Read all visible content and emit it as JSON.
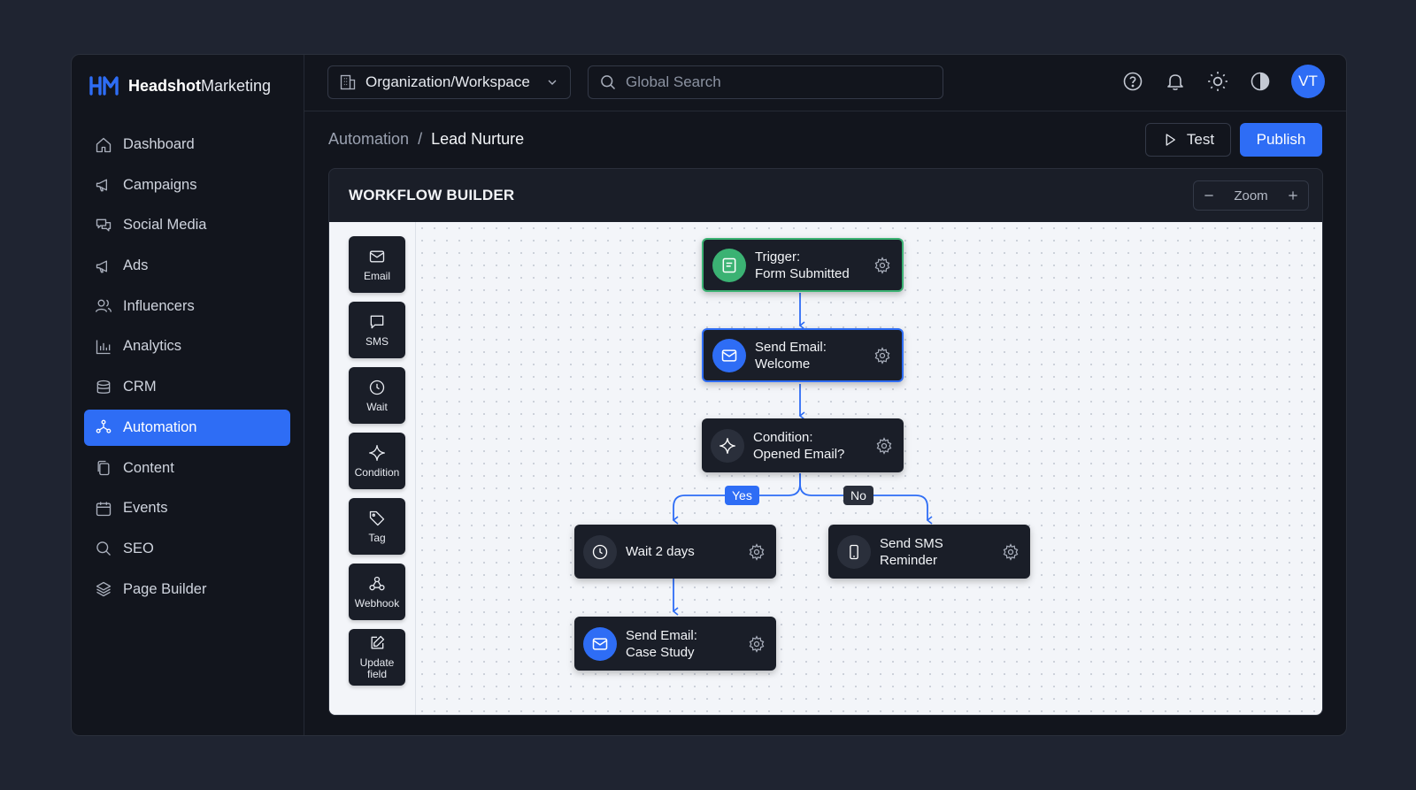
{
  "brand": {
    "bold": "Headshot",
    "regular": "Marketing"
  },
  "sidebar": {
    "items": [
      {
        "label": "Dashboard",
        "icon": "home-icon"
      },
      {
        "label": "Campaigns",
        "icon": "megaphone-icon"
      },
      {
        "label": "Social Media",
        "icon": "chat-icon"
      },
      {
        "label": "Ads",
        "icon": "megaphone-icon"
      },
      {
        "label": "Influencers",
        "icon": "users-icon"
      },
      {
        "label": "Analytics",
        "icon": "bar-chart-icon"
      },
      {
        "label": "CRM",
        "icon": "database-icon"
      },
      {
        "label": "Automation",
        "icon": "automation-icon",
        "active": true
      },
      {
        "label": "Content",
        "icon": "copy-icon"
      },
      {
        "label": "Events",
        "icon": "calendar-icon"
      },
      {
        "label": "SEO",
        "icon": "search-icon"
      },
      {
        "label": "Page Builder",
        "icon": "layers-icon"
      }
    ]
  },
  "header": {
    "workspace": "Organization/Workspace",
    "search_placeholder": "Global Search",
    "avatar": "VT"
  },
  "breadcrumb": {
    "parent": "Automation",
    "separator": "/",
    "current": "Lead Nurture"
  },
  "actions": {
    "test": "Test",
    "publish": "Publish"
  },
  "workflow": {
    "title": "WORKFLOW BUILDER",
    "zoom_label": "Zoom",
    "palette": [
      {
        "label": "Email",
        "icon": "mail-icon"
      },
      {
        "label": "SMS",
        "icon": "message-icon"
      },
      {
        "label": "Wait",
        "icon": "clock-icon"
      },
      {
        "label": "Condition",
        "icon": "sparkle-icon"
      },
      {
        "label": "Tag",
        "icon": "tag-icon"
      },
      {
        "label": "Webhook",
        "icon": "webhook-icon"
      },
      {
        "label": "Update field",
        "icon": "edit-icon"
      }
    ],
    "nodes": {
      "trigger": {
        "line1": "Trigger:",
        "line2": "Form Submitted"
      },
      "email_welcome": {
        "line1": "Send Email:",
        "line2": "Welcome"
      },
      "condition": {
        "line1": "Condition:",
        "line2": "Opened Email?"
      },
      "wait": {
        "line1": "Wait 2 days",
        "line2": ""
      },
      "sms": {
        "line1": "Send SMS",
        "line2": "Reminder"
      },
      "email_case": {
        "line1": "Send Email:",
        "line2": "Case Study"
      }
    },
    "branches": {
      "yes": "Yes",
      "no": "No"
    }
  },
  "colors": {
    "accent": "#2e6df5",
    "trigger": "#3bb273",
    "bg": "#12151d"
  }
}
